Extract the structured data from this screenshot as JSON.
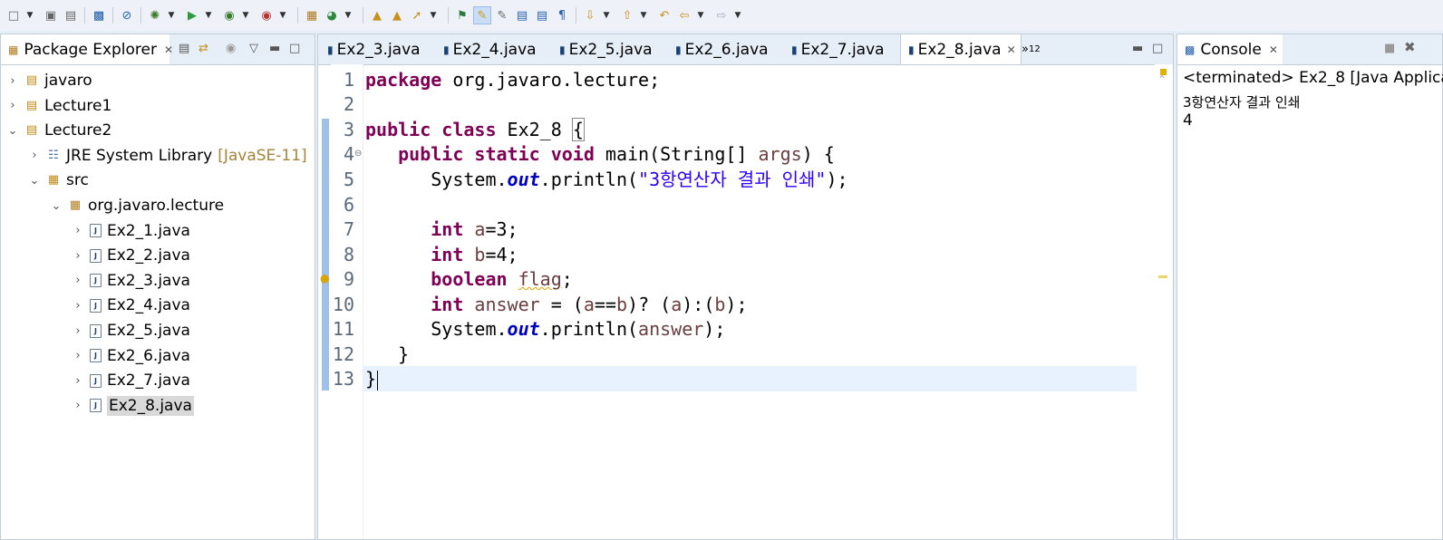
{
  "toolbar": {
    "icons": [
      "new-icon",
      "save-icon",
      "save-all-icon",
      "terminal-icon",
      "skip-breakpoints-icon",
      "debug-icon",
      "run-icon",
      "coverage-icon",
      "external-tools-icon",
      "new-java-package-icon",
      "new-java-class-icon",
      "open-type-icon",
      "open-task-icon",
      "search-icon",
      "toggle-highlight-icon",
      "toggle-mark-occurrences-icon",
      "block-selection-icon",
      "show-whitespace-icon",
      "next-annotation-icon",
      "previous-annotation-icon",
      "last-edit-icon",
      "back-icon",
      "forward-icon"
    ]
  },
  "package_explorer": {
    "title": "Package Explorer",
    "tree": [
      {
        "label": "javaro",
        "level": 0,
        "expanded": false,
        "type": "project"
      },
      {
        "label": "Lecture1",
        "level": 0,
        "expanded": false,
        "type": "project"
      },
      {
        "label": "Lecture2",
        "level": 0,
        "expanded": true,
        "type": "project"
      },
      {
        "label": "JRE System Library",
        "suffix": "[JavaSE-11]",
        "level": 1,
        "expanded": false,
        "type": "library"
      },
      {
        "label": "src",
        "level": 1,
        "expanded": true,
        "type": "source-folder"
      },
      {
        "label": "org.javaro.lecture",
        "level": 2,
        "expanded": true,
        "type": "package"
      },
      {
        "label": "Ex2_1.java",
        "level": 3,
        "type": "file"
      },
      {
        "label": "Ex2_2.java",
        "level": 3,
        "type": "file"
      },
      {
        "label": "Ex2_3.java",
        "level": 3,
        "type": "file"
      },
      {
        "label": "Ex2_4.java",
        "level": 3,
        "type": "file"
      },
      {
        "label": "Ex2_5.java",
        "level": 3,
        "type": "file"
      },
      {
        "label": "Ex2_6.java",
        "level": 3,
        "type": "file"
      },
      {
        "label": "Ex2_7.java",
        "level": 3,
        "type": "file"
      },
      {
        "label": "Ex2_8.java",
        "level": 3,
        "type": "file",
        "selected": true
      }
    ]
  },
  "editor": {
    "tabs": [
      "Ex2_3.java",
      "Ex2_4.java",
      "Ex2_5.java",
      "Ex2_6.java",
      "Ex2_7.java",
      "Ex2_8.java"
    ],
    "active_tab": "Ex2_8.java",
    "overflow_label": "»",
    "overflow_count": "12",
    "line_numbers": [
      "1",
      "2",
      "3",
      "4",
      "5",
      "6",
      "7",
      "8",
      "9",
      "10",
      "11",
      "12",
      "13"
    ],
    "code": {
      "l1_kw": "package",
      "l1_rest": " org.javaro.lecture;",
      "l3_kw1": "public",
      "l3_kw2": "class",
      "l3_rest": " Ex2_8 ",
      "l3_brace": "{",
      "l4_kw1": "public",
      "l4_kw2": "static",
      "l4_kw3": "void",
      "l4_mid": " main(String[] ",
      "l4_var": "args",
      "l4_end": ") {",
      "l5_a": "System.",
      "l5_fld": "out",
      "l5_b": ".println(",
      "l5_str": "\"3항연산자 결과 인쇄\"",
      "l5_c": ");",
      "l7_kw": "int",
      "l7_var": "a",
      "l7_rest": "=3;",
      "l8_kw": "int",
      "l8_var": "b",
      "l8_rest": "=4;",
      "l9_kw": "boolean",
      "l9_var": "flag",
      "l9_rest": ";",
      "l10_kw": "int",
      "l10_var": "answer",
      "l10_a": " = (",
      "l10_va": "a",
      "l10_b": "==",
      "l10_vb": "b",
      "l10_c": ")? (",
      "l10_va2": "a",
      "l10_d": "):(",
      "l10_vb2": "b",
      "l10_e": ");",
      "l11_a": "System.",
      "l11_fld": "out",
      "l11_b": ".println(",
      "l11_var": "answer",
      "l11_c": ");",
      "l12": "}",
      "l13": "}"
    }
  },
  "console": {
    "title": "Console",
    "status": "<terminated> Ex2_8 [Java Applica",
    "output": [
      "3항연산자 결과 인쇄",
      "4"
    ]
  },
  "colors": {
    "keyword": "#7f0055",
    "field": "#0000c0",
    "string": "#2a00ff",
    "variable": "#6a3e3e",
    "current_line": "#e8f2fe"
  }
}
